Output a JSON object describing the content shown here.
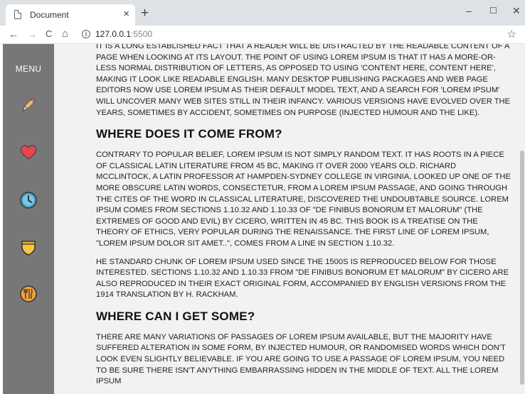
{
  "browser": {
    "tab_title": "Document",
    "tab_close": "×",
    "new_tab": "+",
    "minimize": "–",
    "maximize": "☐",
    "close": "✕",
    "url_host": "127.0.0.1",
    "url_port": ":5500",
    "back": "←",
    "forward": "→",
    "reload": "C",
    "home": "⌂",
    "info": "i",
    "bookmark": "☆"
  },
  "sidebar": {
    "menu_label": "MENU",
    "icons": [
      "pencil-icon",
      "heart-icon",
      "clock-icon",
      "shield-icon",
      "dining-icon"
    ]
  },
  "article": {
    "p1": "It is a long established fact that a reader will be distracted by the readable content of a page when looking at its layout. The point of using Lorem Ipsum is that it has a more-or-less normal distribution of letters, as opposed to using 'Content here, content here', making it look like readable English. Many desktop publishing packages and web page editors now use Lorem Ipsum as their default model text, and a search for 'lorem ipsum' will uncover many web sites still in their infancy. Various versions have evolved over the years, sometimes by accident, sometimes on purpose (injected humour and the like).",
    "h2": "Where does it come from?",
    "p2": "Contrary to popular belief, Lorem Ipsum is not simply random text. It has roots in a piece of classical Latin literature from 45 BC, making it over 2000 years old. Richard McClintock, a Latin professor at Hampden-Sydney College in Virginia, looked up one of the more obscure Latin words, consectetur, from a Lorem Ipsum passage, and going through the cites of the word in classical literature, discovered the undoubtable source. Lorem Ipsum comes from sections 1.10.32 and 1.10.33 of \"de Finibus Bonorum et Malorum\" (The Extremes of Good and Evil) by Cicero, written in 45 BC. This book is a treatise on the theory of ethics, very popular during the Renaissance. The first line of Lorem Ipsum, \"Lorem ipsum dolor sit amet..\", comes from a line in section 1.10.32.",
    "p3": "he standard chunk of Lorem Ipsum used since the 1500s is reproduced below for those interested. Sections 1.10.32 and 1.10.33 from \"de Finibus Bonorum et Malorum\" by Cicero are also reproduced in their exact original form, accompanied by English versions from the 1914 translation by H. Rackham.",
    "h3": "Where can I get some?",
    "p4": "There are many variations of passages of Lorem Ipsum available, but the majority have suffered alteration in some form, by injected humour, or randomised words which don't look even slightly believable. If you are going to use a passage of Lorem Ipsum, you need to be sure there isn't anything embarrassing hidden in the middle of text. All the Lorem Ipsum"
  },
  "colors": {
    "sidebar": "#777777",
    "content_bg": "#f2f2f2",
    "heart": "#e8434f",
    "clock": "#4aa3c9",
    "shield": "#f5c842",
    "dining": "#f0a23a",
    "pencil": "#e9b96e"
  }
}
